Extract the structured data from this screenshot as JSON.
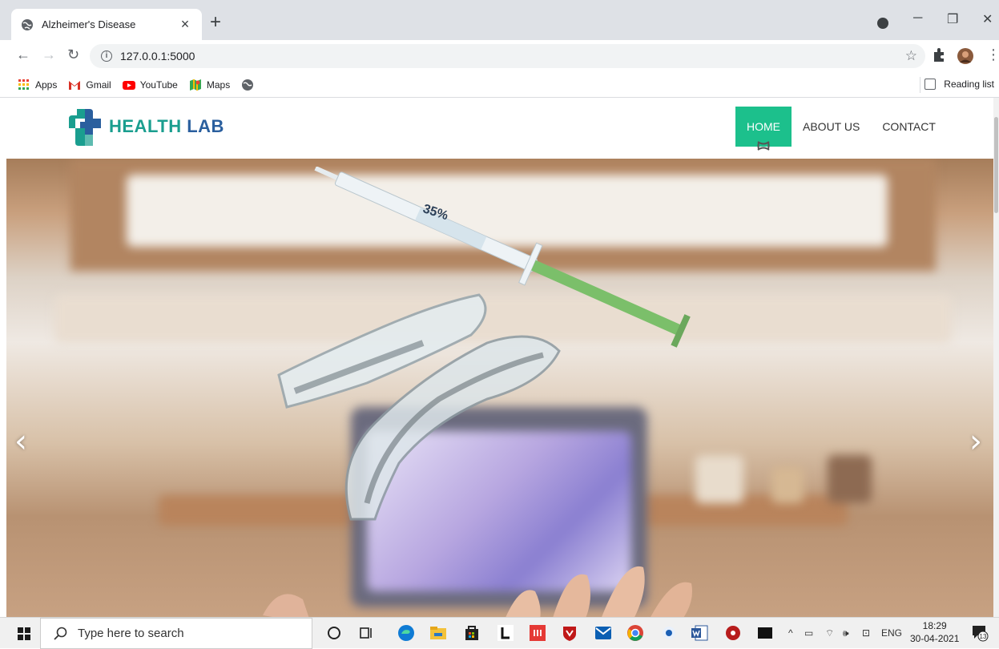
{
  "browser": {
    "tab_title": "Alzheimer's Disease",
    "tab_close": "×",
    "new_tab": "+",
    "url": "127.0.0.1:5000",
    "reading_list": "Reading list",
    "bookmarks": [
      {
        "label": "Apps",
        "icon": "apps-grid-icon",
        "color": "#ea4335"
      },
      {
        "label": "Gmail",
        "icon": "gmail-icon",
        "color": "#d93025"
      },
      {
        "label": "YouTube",
        "icon": "youtube-icon",
        "color": "#ff0000"
      },
      {
        "label": "Maps",
        "icon": "maps-icon",
        "color": "#34a853"
      }
    ]
  },
  "site": {
    "logo_part1": "HEALTH",
    "logo_part2": "LAB",
    "nav": [
      {
        "label": "HOME",
        "active": true
      },
      {
        "label": "ABOUT US",
        "active": false
      },
      {
        "label": "CONTACT",
        "active": false
      }
    ],
    "accent_color": "#1cc08c",
    "hero": {
      "syringe_label": "35%",
      "prev_arrow": "‹",
      "next_arrow": "›"
    }
  },
  "taskbar": {
    "search_placeholder": "Type here to search",
    "language": "ENG",
    "time": "18:29",
    "date": "30-04-2021",
    "notifications": "13"
  }
}
